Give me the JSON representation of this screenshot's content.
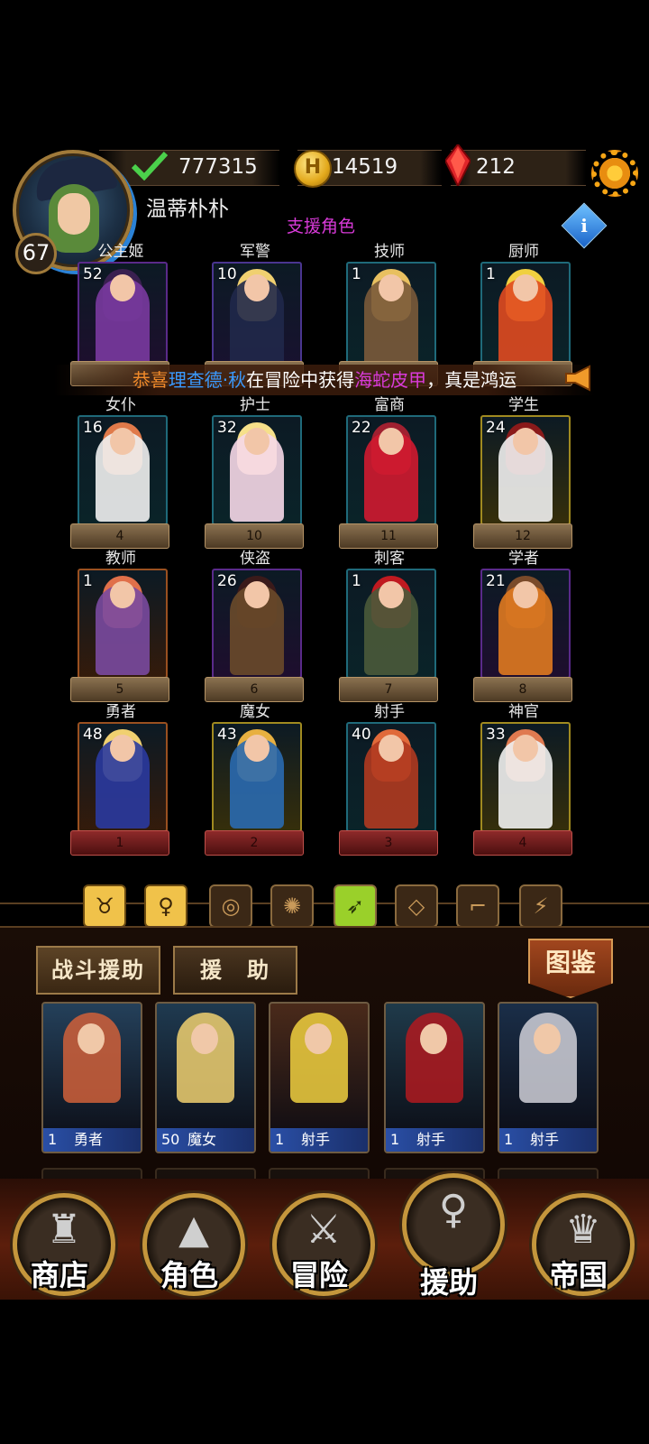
{
  "player": {
    "name": "温蒂朴朴",
    "level": "67"
  },
  "resources": {
    "exp": "777315",
    "gold": "14519",
    "gems": "212"
  },
  "section_title": "支援角色",
  "marquee": {
    "pre": "恭喜",
    "player": "理查德·秋",
    "mid": "在冒险中获得",
    "item": "海蛇皮甲",
    "post": "，真是鸿运"
  },
  "grid": [
    {
      "label": "公主姬",
      "level": "52",
      "plate": ""
    },
    {
      "label": "军警",
      "level": "10",
      "plate": ""
    },
    {
      "label": "技师",
      "level": "1",
      "plate": ""
    },
    {
      "label": "厨师",
      "level": "1",
      "plate": ""
    },
    {
      "label": "女仆",
      "level": "16",
      "plate": "4"
    },
    {
      "label": "护士",
      "level": "32",
      "plate": "10"
    },
    {
      "label": "富商",
      "level": "22",
      "plate": "11"
    },
    {
      "label": "学生",
      "level": "24",
      "plate": "12"
    },
    {
      "label": "教师",
      "level": "1",
      "plate": "5"
    },
    {
      "label": "侠盗",
      "level": "26",
      "plate": "6"
    },
    {
      "label": "刺客",
      "level": "1",
      "plate": "7"
    },
    {
      "label": "学者",
      "level": "21",
      "plate": "8"
    },
    {
      "label": "勇者",
      "level": "48",
      "plate": "1"
    },
    {
      "label": "魔女",
      "level": "43",
      "plate": "2"
    },
    {
      "label": "射手",
      "level": "40",
      "plate": "3"
    },
    {
      "label": "神官",
      "level": "33",
      "plate": "4"
    }
  ],
  "filters": [
    "bull-icon",
    "figure-icon",
    "target-icon",
    "wheel-icon",
    "bow-icon",
    "diamond-icon",
    "boot-icon",
    "claw-icon"
  ],
  "tabs": {
    "battle": "战斗援助",
    "assist": "援　助",
    "codex": "图鉴"
  },
  "support_cards": [
    {
      "level": "1",
      "role": "勇者"
    },
    {
      "level": "50",
      "role": "魔女"
    },
    {
      "level": "1",
      "role": "射手"
    },
    {
      "level": "1",
      "role": "射手"
    },
    {
      "level": "1",
      "role": "射手"
    }
  ],
  "nav": {
    "shop": "商店",
    "character": "角色",
    "adventure": "冒险",
    "assist": "援助",
    "empire": "帝国"
  },
  "colors": {
    "accent": "#c4963c",
    "highlight": "#d93ad9",
    "blue_name": "#3a9aff"
  }
}
